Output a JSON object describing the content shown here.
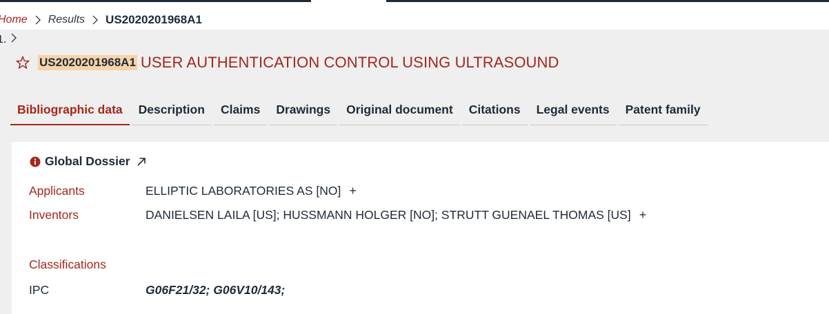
{
  "breadcrumb": {
    "home": "Home",
    "results": "Results",
    "current": "US2020201968A1"
  },
  "result_index": "1.",
  "document": {
    "pub_number": "US2020201968A1",
    "title": "USER AUTHENTICATION CONTROL USING ULTRASOUND"
  },
  "tabs": [
    {
      "label": "Bibliographic data",
      "active": true
    },
    {
      "label": "Description",
      "active": false
    },
    {
      "label": "Claims",
      "active": false
    },
    {
      "label": "Drawings",
      "active": false
    },
    {
      "label": "Original document",
      "active": false
    },
    {
      "label": "Citations",
      "active": false
    },
    {
      "label": "Legal events",
      "active": false
    },
    {
      "label": "Patent family",
      "active": false
    }
  ],
  "biblio": {
    "global_dossier": "Global Dossier",
    "applicants_label": "Applicants",
    "applicants_value": "ELLIPTIC LABORATORIES AS [NO]",
    "inventors_label": "Inventors",
    "inventors_value": "DANIELSEN LAILA [US]; HUSSMANN HOLGER [NO]; STRUTT GUENAEL THOMAS [US]",
    "expand_symbol": "+",
    "classifications_label": "Classifications",
    "ipc_label": "IPC",
    "ipc_value": "G06F21/32; G06V10/143;"
  },
  "colors": {
    "accent": "#a3271c",
    "text": "#1e2a3a",
    "highlight": "#f8d3a8",
    "panel": "#efefef"
  },
  "icons": [
    "chevron-right-icon",
    "star-icon",
    "info-icon",
    "external-link-icon"
  ]
}
